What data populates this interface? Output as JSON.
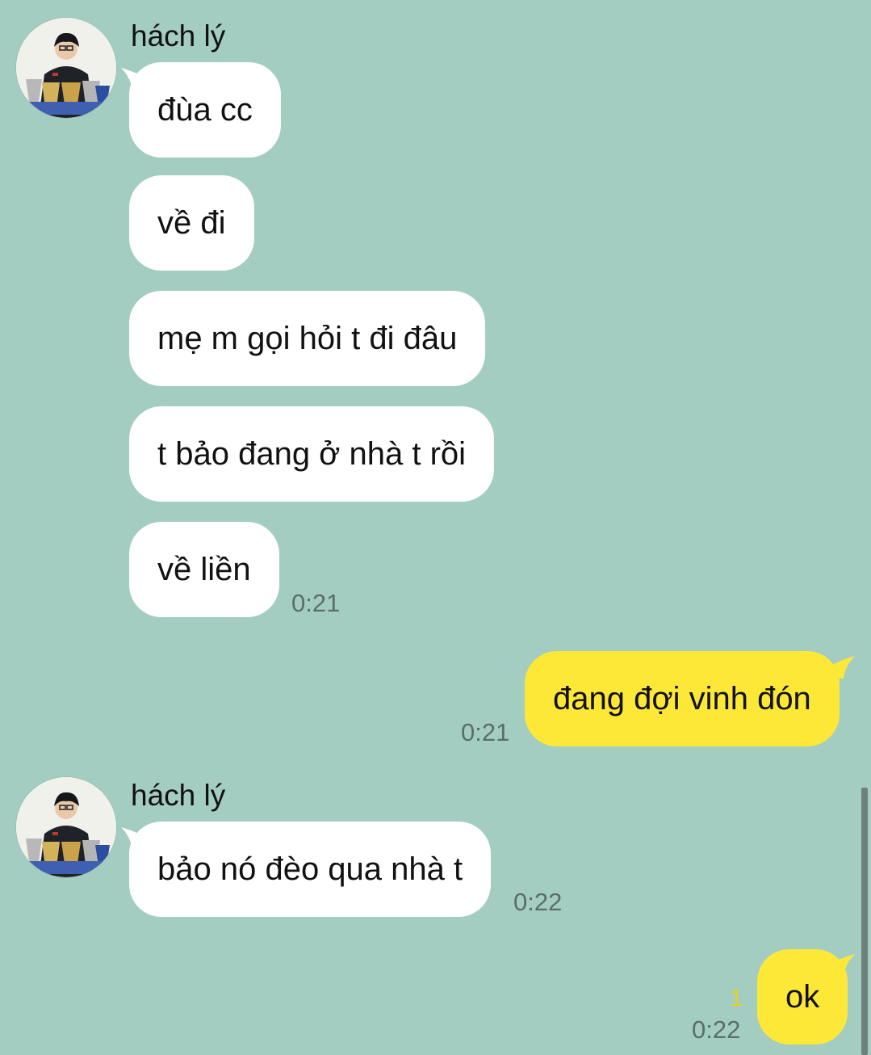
{
  "colors": {
    "background": "#a4cdc1",
    "incoming_bubble": "#ffffff",
    "outgoing_bubble": "#fde838",
    "unread_count": "#e6cf2a"
  },
  "groups": [
    {
      "sender": "hách lý",
      "avatar_icon": "profile-photo-with-trophies",
      "messages": [
        "đùa cc",
        "về đi",
        "mẹ m gọi hỏi t đi đâu",
        "t bảo đang ở nhà t rồi",
        "về liền"
      ],
      "time": "0:21"
    },
    {
      "sender": "hách lý",
      "avatar_icon": "profile-photo-with-trophies",
      "messages": [
        "bảo nó đèo qua nhà t"
      ],
      "time": "0:22"
    }
  ],
  "outgoing": [
    {
      "text": "đang đợi vinh đón",
      "time": "0:21",
      "unread": ""
    },
    {
      "text": "ok",
      "time": "0:22",
      "unread": "1"
    }
  ]
}
